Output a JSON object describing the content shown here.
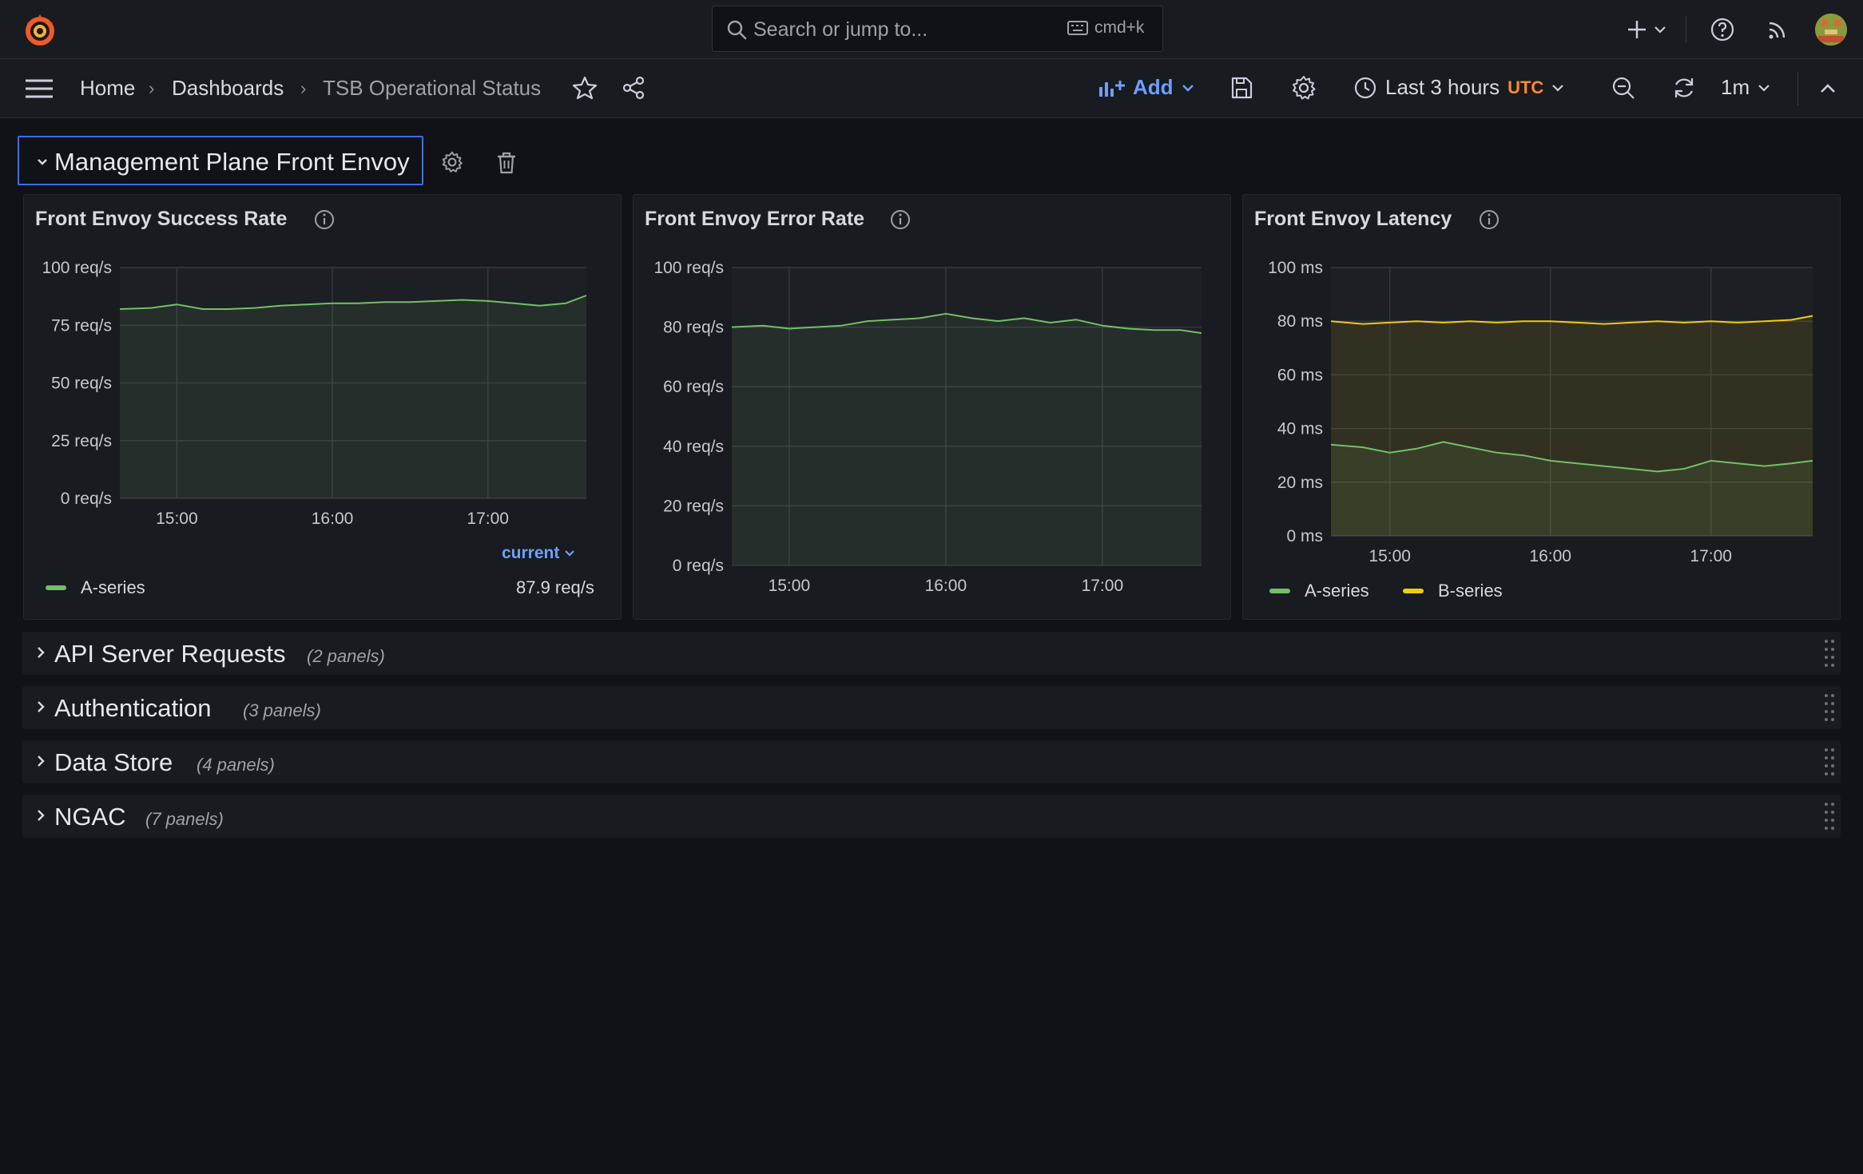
{
  "topbar": {
    "search_placeholder": "Search or jump to...",
    "shortcut": "cmd+k"
  },
  "breadcrumb": {
    "home": "Home",
    "dashboards": "Dashboards",
    "current": "TSB Operational Status"
  },
  "toolbar": {
    "add_label": "Add",
    "time_range": "Last 3 hours",
    "timezone": "UTC",
    "refresh_interval": "1m"
  },
  "row_open": {
    "title": "Management Plane Front Envoy"
  },
  "panels": [
    {
      "title": "Front Envoy Success Rate",
      "legend_header": "current",
      "legend": [
        {
          "name": "A-series",
          "color": "#73bf69",
          "value": "87.9 req/s"
        }
      ]
    },
    {
      "title": "Front Envoy Error Rate",
      "legend": []
    },
    {
      "title": "Front Envoy Latency",
      "legend": [
        {
          "name": "A-series",
          "color": "#73bf69"
        },
        {
          "name": "B-series",
          "color": "#f2cc0c"
        }
      ]
    }
  ],
  "collapsed_rows": [
    {
      "title": "API Server Requests",
      "count": "(2 panels)"
    },
    {
      "title": "Authentication",
      "count": "(3 panels)"
    },
    {
      "title": "Data Store",
      "count": "(4 panels)"
    },
    {
      "title": "NGAC",
      "count": "(7 panels)"
    }
  ],
  "chart_data": [
    {
      "type": "line",
      "title": "Front Envoy Success Rate",
      "x_ticks": [
        "15:00",
        "16:00",
        "17:00"
      ],
      "y_ticks": [
        "0 req/s",
        "25 req/s",
        "50 req/s",
        "75 req/s",
        "100 req/s"
      ],
      "ylim": [
        0,
        100
      ],
      "x": [
        "14:38",
        "14:50",
        "15:00",
        "15:10",
        "15:20",
        "15:30",
        "15:40",
        "15:50",
        "16:00",
        "16:10",
        "16:20",
        "16:30",
        "16:40",
        "16:50",
        "17:00",
        "17:10",
        "17:20",
        "17:30",
        "17:38"
      ],
      "series": [
        {
          "name": "A-series",
          "color": "#73bf69",
          "fill": true,
          "values": [
            82,
            82.5,
            84,
            82,
            82,
            82.5,
            83.5,
            84,
            84.5,
            84.5,
            85,
            85,
            85.5,
            86,
            85.5,
            84.5,
            83.5,
            84.5,
            87.9
          ]
        }
      ],
      "grid": true
    },
    {
      "type": "line",
      "title": "Front Envoy Error Rate",
      "x_ticks": [
        "15:00",
        "16:00",
        "17:00"
      ],
      "y_ticks": [
        "0 req/s",
        "20 req/s",
        "40 req/s",
        "60 req/s",
        "80 req/s",
        "100 req/s"
      ],
      "ylim": [
        0,
        100
      ],
      "x": [
        "14:38",
        "14:50",
        "15:00",
        "15:10",
        "15:20",
        "15:30",
        "15:40",
        "15:50",
        "16:00",
        "16:10",
        "16:20",
        "16:30",
        "16:40",
        "16:50",
        "17:00",
        "17:10",
        "17:20",
        "17:30",
        "17:38"
      ],
      "series": [
        {
          "name": "A-series",
          "color": "#73bf69",
          "fill": true,
          "values": [
            80,
            80.5,
            79.5,
            80,
            80.5,
            82,
            82.5,
            83,
            84.5,
            83,
            82,
            83,
            81.5,
            82.5,
            80.5,
            79.5,
            79,
            79,
            78
          ]
        }
      ],
      "grid": true
    },
    {
      "type": "line",
      "title": "Front Envoy Latency",
      "x_ticks": [
        "15:00",
        "16:00",
        "17:00"
      ],
      "y_ticks": [
        "0 ms",
        "20 ms",
        "40 ms",
        "60 ms",
        "80 ms",
        "100 ms"
      ],
      "ylim": [
        0,
        100
      ],
      "x": [
        "14:38",
        "14:50",
        "15:00",
        "15:10",
        "15:20",
        "15:30",
        "15:40",
        "15:50",
        "16:00",
        "16:10",
        "16:20",
        "16:30",
        "16:40",
        "16:50",
        "17:00",
        "17:10",
        "17:20",
        "17:30",
        "17:38"
      ],
      "series": [
        {
          "name": "A-series",
          "color": "#73bf69",
          "fill": true,
          "values": [
            34,
            33,
            31,
            32.5,
            35,
            33,
            31,
            30,
            28,
            27,
            26,
            25,
            24,
            25,
            28,
            27,
            26,
            27,
            28
          ]
        },
        {
          "name": "B-series",
          "color": "#f2cc0c",
          "fill": true,
          "values": [
            80,
            79,
            79.5,
            80,
            79.5,
            80,
            79.5,
            80,
            80,
            79.5,
            79,
            79.5,
            80,
            79.5,
            80,
            79.5,
            80,
            80.5,
            82
          ]
        }
      ],
      "grid": true
    }
  ]
}
